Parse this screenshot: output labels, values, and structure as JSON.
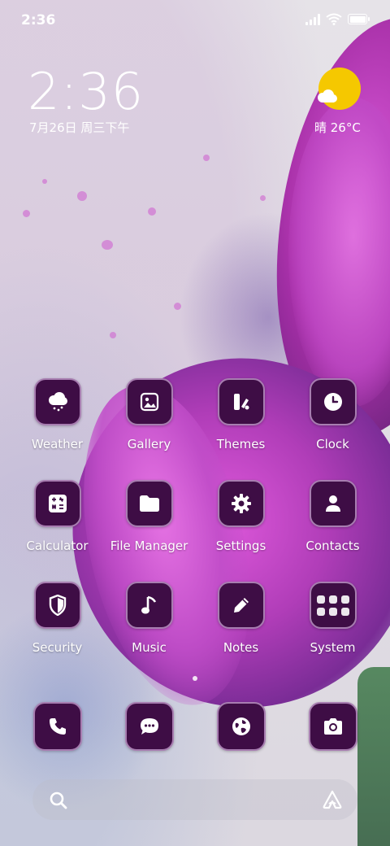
{
  "status_bar": {
    "time": "2:36",
    "icons": [
      "signal-icon",
      "wifi-icon",
      "battery-icon"
    ]
  },
  "widget": {
    "clock": "2:36",
    "date": "7月26日 周三下午",
    "weather": "晴 26°C"
  },
  "apps": [
    {
      "label": "Weather",
      "icon": "cloud-rain-icon"
    },
    {
      "label": "Gallery",
      "icon": "image-icon"
    },
    {
      "label": "Themes",
      "icon": "themes-icon"
    },
    {
      "label": "Clock",
      "icon": "clock-icon"
    },
    {
      "label": "Calculator",
      "icon": "calculator-icon"
    },
    {
      "label": "File Manager",
      "icon": "folder-icon"
    },
    {
      "label": "Settings",
      "icon": "gear-icon"
    },
    {
      "label": "Contacts",
      "icon": "person-icon"
    },
    {
      "label": "Security",
      "icon": "shield-icon"
    },
    {
      "label": "Music",
      "icon": "music-note-icon"
    },
    {
      "label": "Notes",
      "icon": "pencil-icon"
    },
    {
      "label": "System",
      "icon": "folder-grid-icon"
    }
  ],
  "dock": [
    {
      "icon": "phone-icon"
    },
    {
      "icon": "chat-icon"
    },
    {
      "icon": "globe-icon"
    },
    {
      "icon": "camera-icon"
    }
  ],
  "search_bar": {
    "icons": [
      "search-icon",
      "assistant-icon"
    ]
  },
  "colors": {
    "icon_bg": "#3e0d45",
    "icon_border": "#a77db0",
    "sun": "#f5c800"
  }
}
